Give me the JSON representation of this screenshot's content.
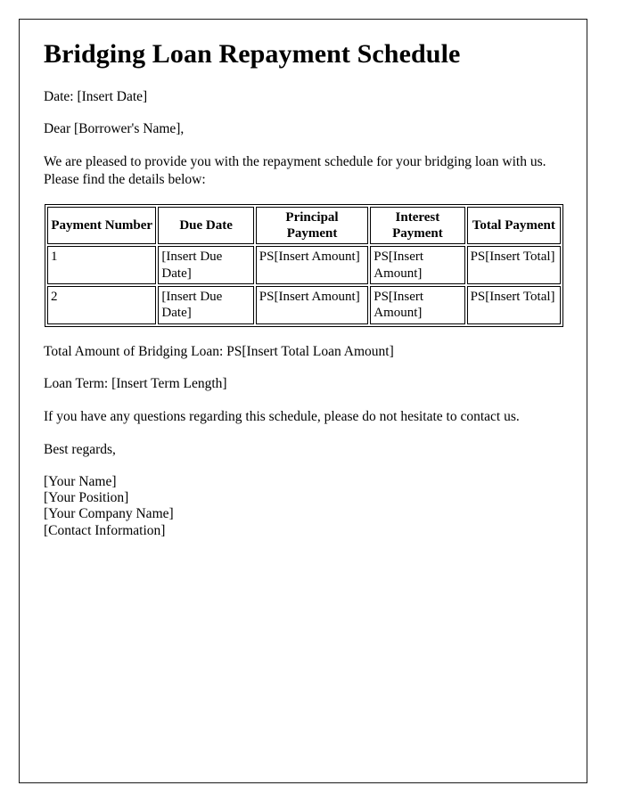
{
  "document": {
    "title": "Bridging Loan Repayment Schedule",
    "date_line": "Date: [Insert Date]",
    "salutation": "Dear [Borrower's Name],",
    "intro_paragraph": "We are pleased to provide you with the repayment schedule for your bridging loan with us. Please find the details below:",
    "total_loan_line": "Total Amount of Bridging Loan: PS[Insert Total Loan Amount]",
    "loan_term_line": "Loan Term: [Insert Term Length]",
    "questions_paragraph": "If you have any questions regarding this schedule, please do not hesitate to contact us.",
    "closing": "Best regards,",
    "signature": {
      "name": "[Your Name]",
      "position": "[Your Position]",
      "company": "[Your Company Name]",
      "contact": "[Contact Information]"
    }
  },
  "schedule_table": {
    "headers": [
      "Payment Number",
      "Due Date",
      "Principal Payment",
      "Interest Payment",
      "Total Payment"
    ],
    "rows": [
      {
        "payment_number": "1",
        "due_date": "[Insert Due Date]",
        "principal_payment": "PS[Insert Amount]",
        "interest_payment": "PS[Insert Amount]",
        "total_payment": "PS[Insert Total]"
      },
      {
        "payment_number": "2",
        "due_date": "[Insert Due Date]",
        "principal_payment": "PS[Insert Amount]",
        "interest_payment": "PS[Insert Amount]",
        "total_payment": "PS[Insert Total]"
      }
    ]
  },
  "colors": {
    "page_background": "#ffffff",
    "text": "#000000",
    "border": "#1a1a1a",
    "table_border": "#000000"
  }
}
